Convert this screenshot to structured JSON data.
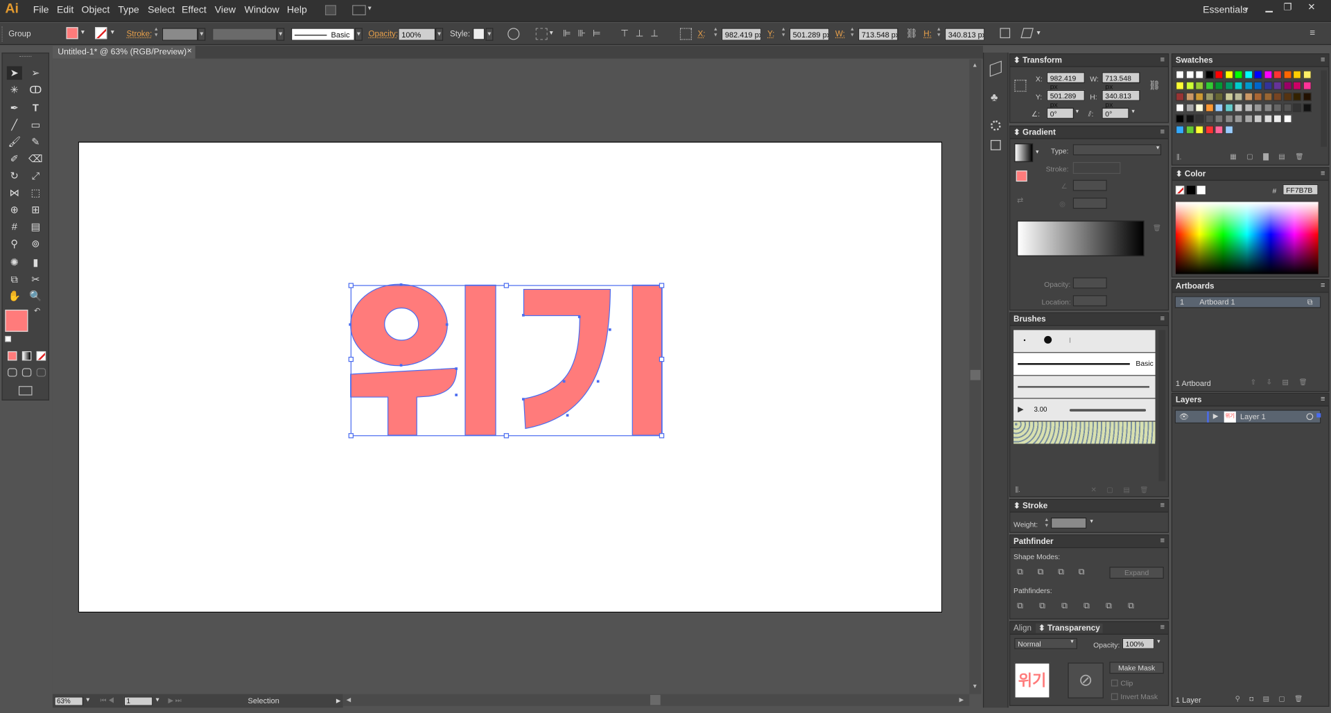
{
  "app": {
    "logo": "Ai",
    "workspace": "Essentials"
  },
  "menu": [
    "File",
    "Edit",
    "Object",
    "Type",
    "Select",
    "Effect",
    "View",
    "Window",
    "Help"
  ],
  "control": {
    "selection": "Group",
    "stroke_label": "Stroke:",
    "brush_name": "Basic",
    "opacity_label": "Opacity:",
    "opacity_value": "100%",
    "style_label": "Style:",
    "x_label": "X:",
    "x": "982.419 px",
    "y_label": "Y:",
    "y": "501.289 px",
    "w_label": "W:",
    "w": "713.548 px",
    "h_label": "H:",
    "h": "340.813 px"
  },
  "document": {
    "tab_title": "Untitled-1* @ 63% (RGB/Preview)",
    "close": "×"
  },
  "artwork": {
    "text": "위기",
    "fill": "#FF7B7B",
    "selection_color": "#4a6cf0"
  },
  "status": {
    "zoom": "63%",
    "page": "1",
    "tool": "Selection"
  },
  "panels": {
    "transform": {
      "title": "Transform",
      "x_label": "X:",
      "x": "982.419 px",
      "y_label": "Y:",
      "y": "501.289 px",
      "w_label": "W:",
      "w": "713.548 px",
      "h_label": "H:",
      "h": "340.813 px",
      "rotate": "0°",
      "shear": "0°"
    },
    "gradient": {
      "title": "Gradient",
      "type_label": "Type:",
      "stroke_label": "Stroke:",
      "opacity_label": "Opacity:",
      "location_label": "Location:"
    },
    "brushes": {
      "title": "Brushes",
      "basic": "Basic",
      "size": "3.00"
    },
    "stroke": {
      "title": "Stroke",
      "weight_label": "Weight:"
    },
    "pathfinder": {
      "title": "Pathfinder",
      "shape_modes": "Shape Modes:",
      "expand": "Expand",
      "pathfinders": "Pathfinders:"
    },
    "transparency": {
      "align_tab": "Align",
      "title": "Transparency",
      "mode": "Normal",
      "opacity_label": "Opacity:",
      "opacity": "100%",
      "make_mask": "Make Mask",
      "clip": "Clip",
      "invert_mask": "Invert Mask",
      "thumb_text": "위기"
    },
    "swatches": {
      "title": "Swatches"
    },
    "color": {
      "title": "Color",
      "hash": "#",
      "hex": "FF7B7B"
    },
    "artboards": {
      "title": "Artboards",
      "row_num": "1",
      "row_name": "Artboard 1",
      "footer": "1 Artboard"
    },
    "layers": {
      "title": "Layers",
      "layer_name": "Layer 1",
      "footer": "1 Layer",
      "thumb_text": "위기"
    }
  }
}
